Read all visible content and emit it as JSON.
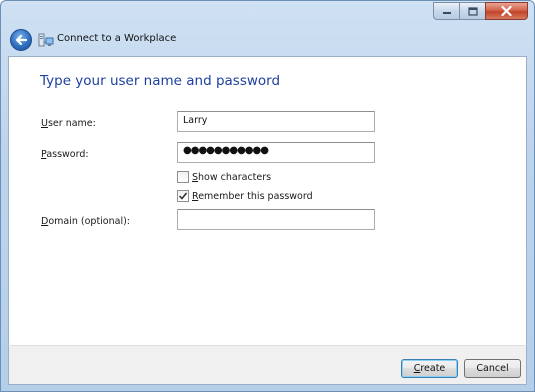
{
  "window": {
    "title": "Connect to a Workplace"
  },
  "nav": {
    "back_icon": "back-arrow-icon",
    "wizard_icon": "network-connection-icon"
  },
  "main": {
    "heading": "Type your user name and password",
    "username": {
      "label_accel": "U",
      "label_rest": "ser name:",
      "value": "Larry"
    },
    "password": {
      "label_accel": "P",
      "label_rest": "assword:",
      "value": "●●●●●●●●●●●"
    },
    "show_characters": {
      "label_accel": "S",
      "label_rest": "how characters",
      "checked": false
    },
    "remember_password": {
      "label_accel": "R",
      "label_rest": "emember this password",
      "checked": true
    },
    "domain": {
      "label_accel": "D",
      "label_rest": "omain (optional):",
      "value": ""
    }
  },
  "footer": {
    "create": {
      "accel": "C",
      "rest": "reate"
    },
    "cancel": "Cancel"
  },
  "colors": {
    "heading": "#1e3f9e",
    "titlebar": "#bcd3ec",
    "close_button": "#c0442a"
  }
}
